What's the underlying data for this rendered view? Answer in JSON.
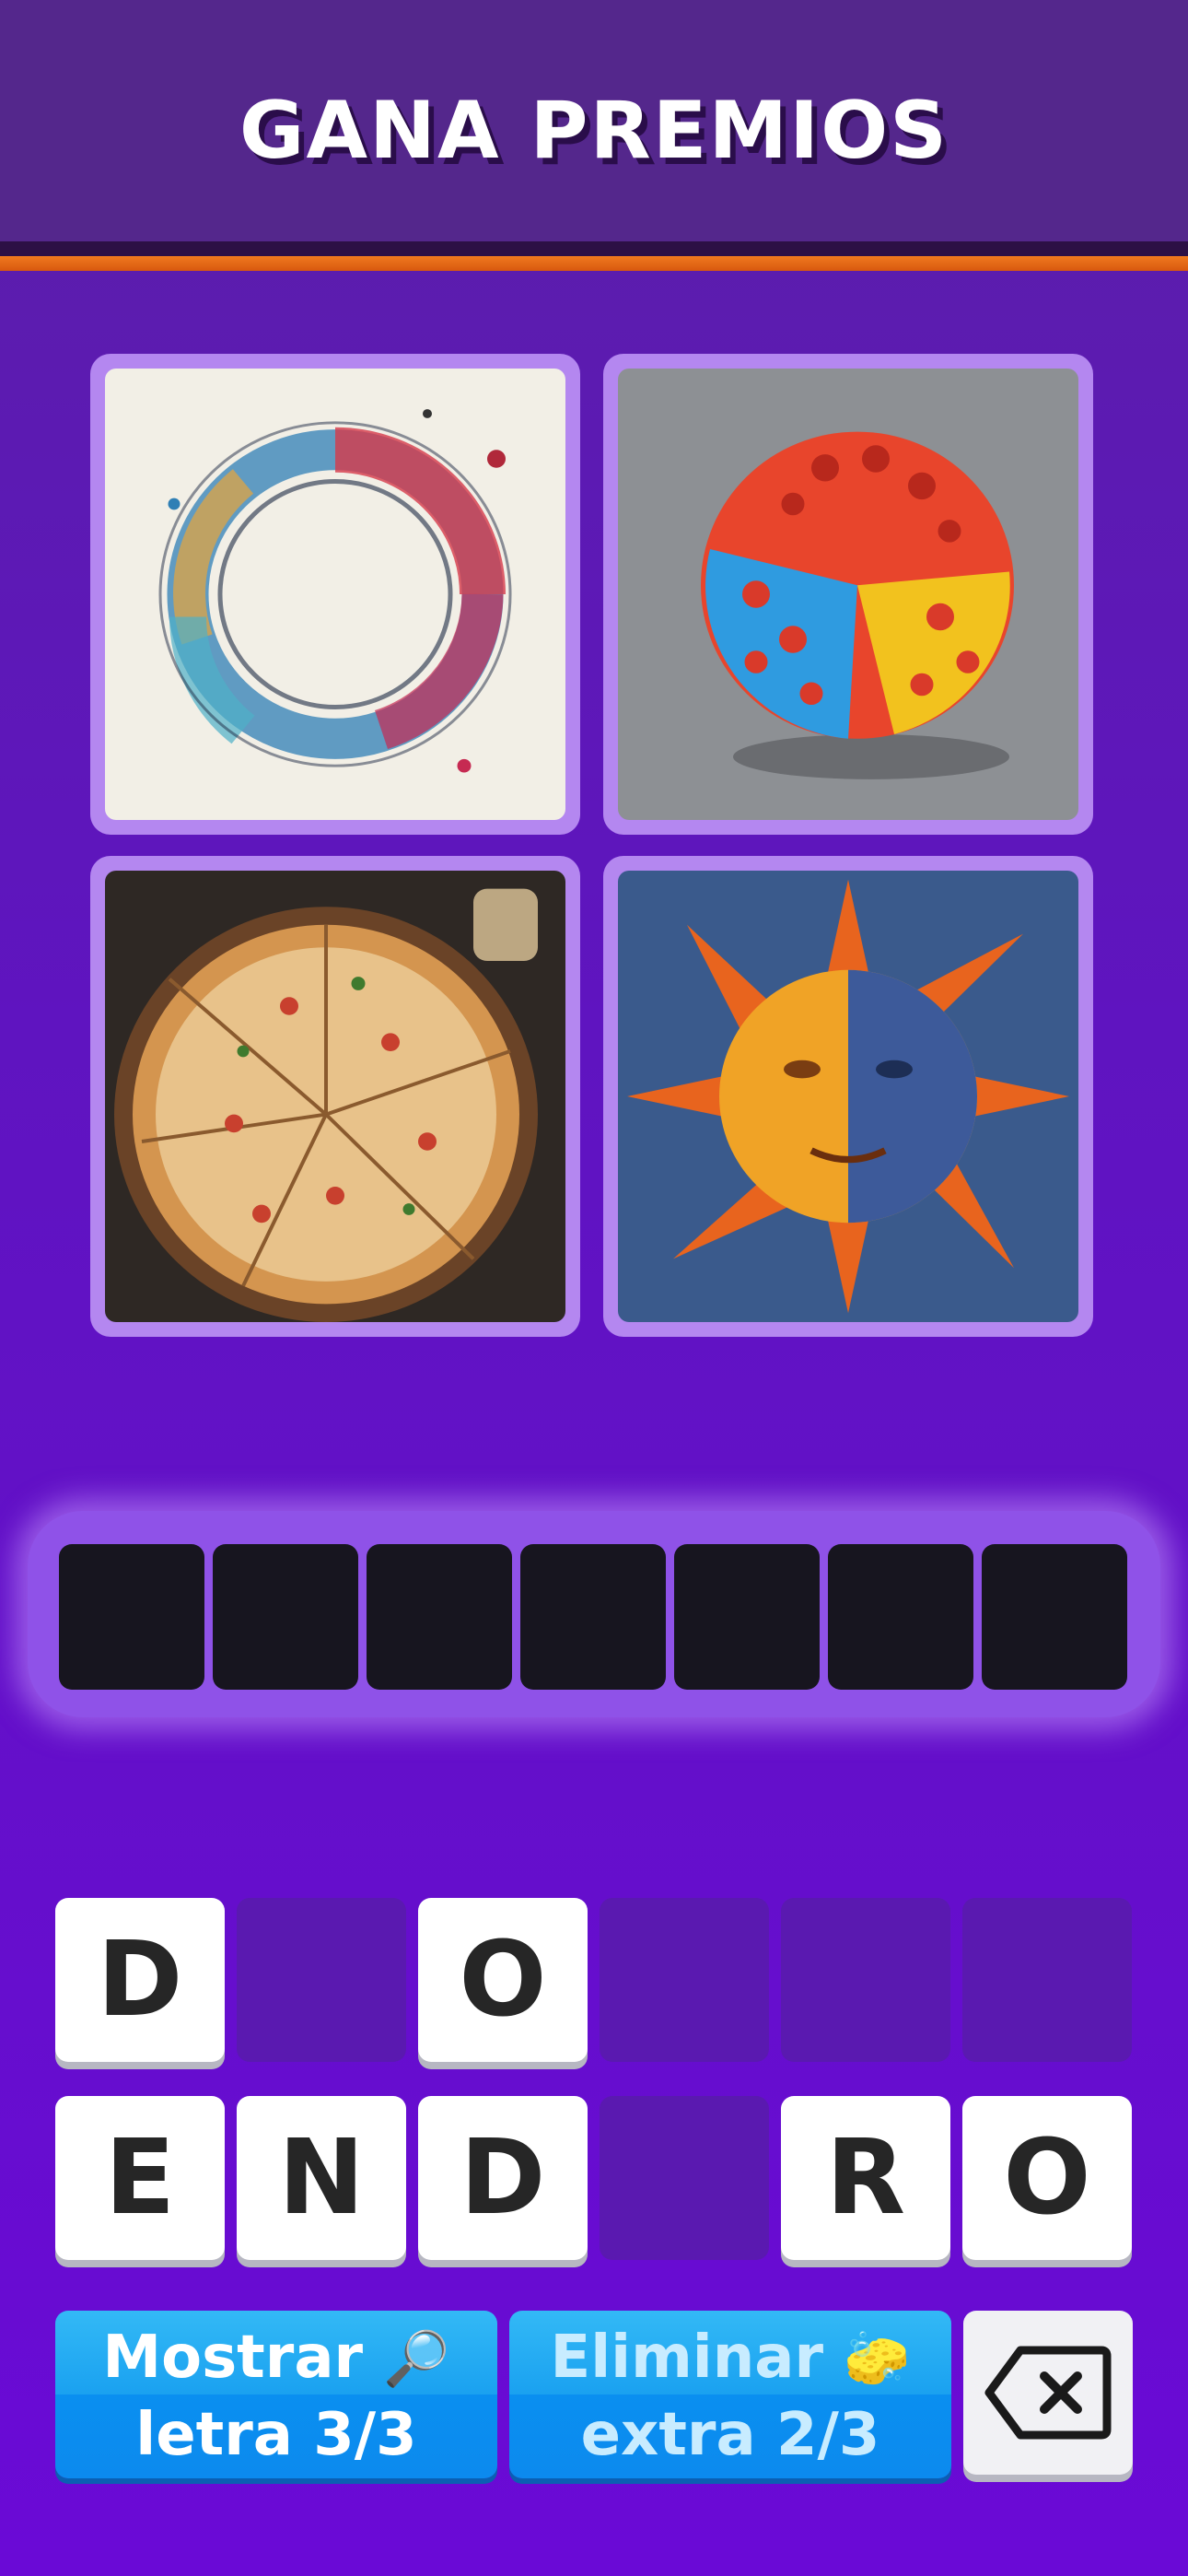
{
  "header": {
    "title": "GANA PREMIOS"
  },
  "images": [
    {
      "name": "watercolor-ring"
    },
    {
      "name": "colored-ball"
    },
    {
      "name": "pizza"
    },
    {
      "name": "sun-painting"
    }
  ],
  "answer": {
    "slots": 7
  },
  "keyboard": {
    "row1": [
      "D",
      "",
      "O",
      "",
      "",
      ""
    ],
    "row2": [
      "E",
      "N",
      "D",
      "",
      "R",
      "O"
    ]
  },
  "buttons": {
    "show_letter": {
      "line1": "Mostrar",
      "icon": "🔎",
      "line2": "letra 3/3"
    },
    "remove_extra": {
      "line1": "Eliminar",
      "icon": "🧽",
      "line2": "extra 2/3"
    },
    "delete_icon": "backspace-icon"
  },
  "colors": {
    "header": "#54278c",
    "accent_orange": "#f07a1e",
    "tile_border": "#b487f0",
    "slot": "#17151f",
    "button_blue": "#1aa1f0"
  }
}
